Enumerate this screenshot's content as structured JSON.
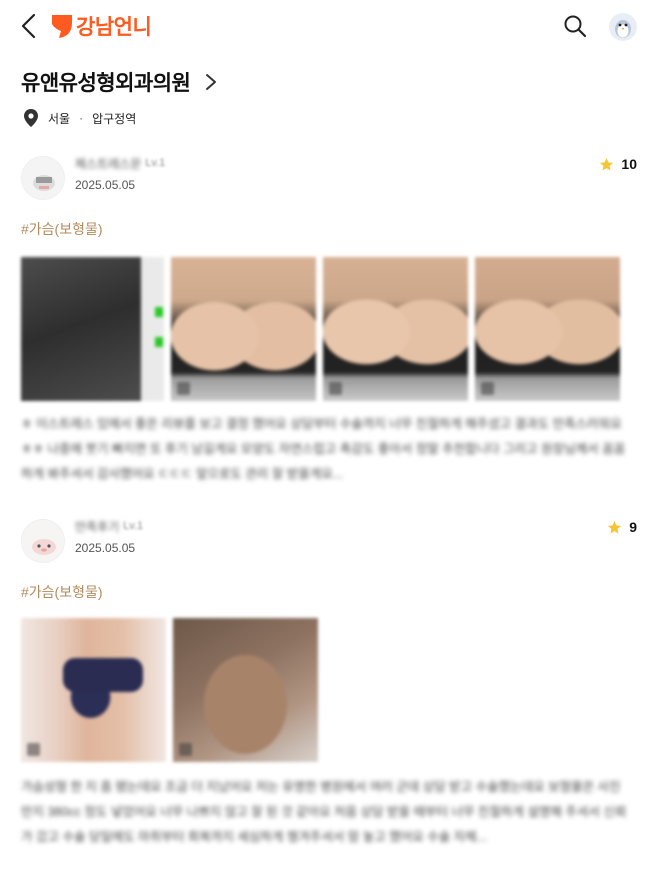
{
  "header": {
    "logo_text": "강남언니",
    "accent_color": "#ff5a1f"
  },
  "clinic": {
    "name": "유앤유성형외과의원",
    "city": "서울",
    "separator": "·",
    "area": "압구정역"
  },
  "reviews": [
    {
      "username": "체스트레스문",
      "level": "Lv.1",
      "date": "2025.05.05",
      "rating": "10",
      "tag": "#가슴(보형물)",
      "photo_count": 4,
      "text": "ㅎ 이스트레스 있에서 좋은 리뷰를 보고 결정 했어요 상담부터 수술까지 너무 친절하게 해주셨고 결과도 만족스러워요 ㅎㅎ 나중에 붓기 빠지면 또 후기 남길게요 모양도 자연스럽고 촉감도 좋아서 정말 추천합니다 그리고 원장님께서 꼼꼼하게 봐주셔서 감사했어요 ㄷㄷㄷ 앞으로도 관리 잘 받을게요..."
    },
    {
      "username": "만족후기",
      "level": "Lv.1",
      "date": "2025.05.05",
      "rating": "9",
      "tag": "#가슴(보형물)",
      "photo_count": 2,
      "text": "가슴성형 한 지 좀 됐는데요 조금 더 지났어요 저는 유명한 병원에서 여러 군데 상담 받고 수술했는데요 보형물은 사진 만지 380cc 정도 넣었어요 너무 나쁘지 않고 잘 된 것 같아요 처음 상담 받을 때부터 너무 친절하게 설명해 주셔서 신뢰가 갔고 수술 당일에도 마취부터 회복까지 세심하게 챙겨주셔서 맘 놓고 했어요 수술 자체..."
    }
  ]
}
